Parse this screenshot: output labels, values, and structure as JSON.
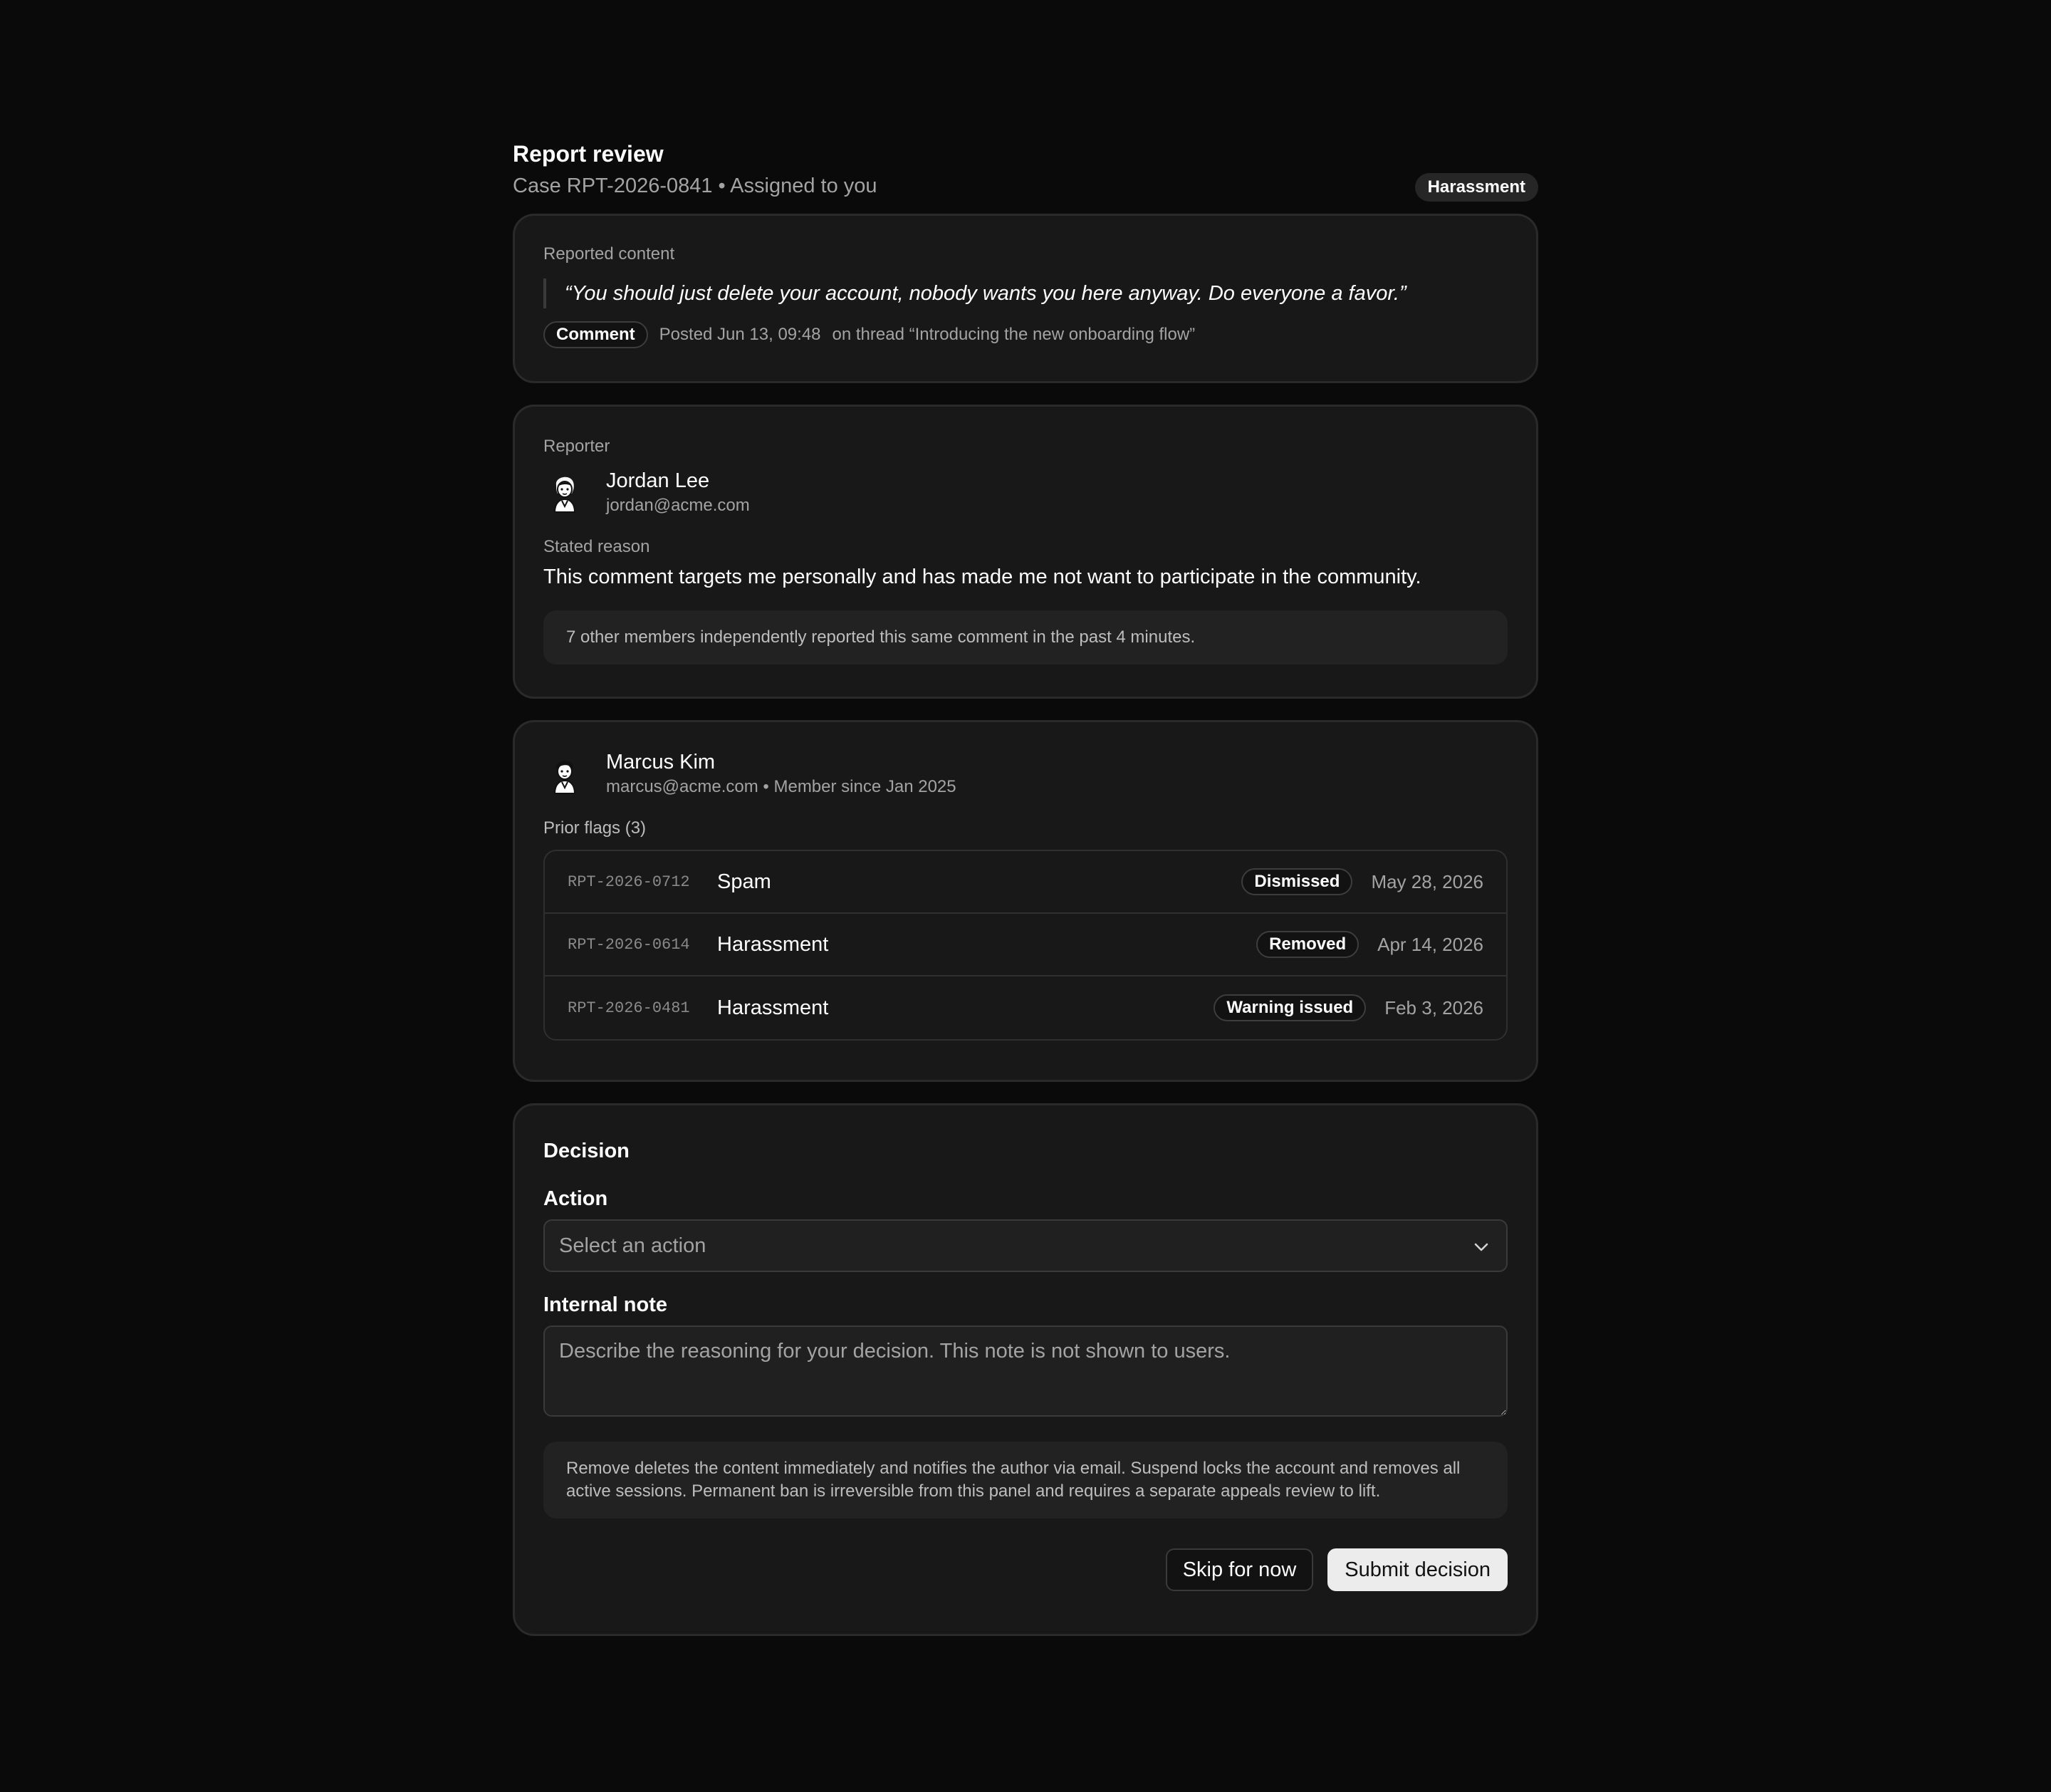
{
  "header": {
    "title": "Report review",
    "subtitle": "Case RPT-2026-0841 • Assigned to you",
    "category_badge": "Harassment"
  },
  "reported_content": {
    "label": "Reported content",
    "quote": "“You should just delete your account, nobody wants you here anyway. Do everyone a favor.”",
    "type_badge": "Comment",
    "posted": "Posted Jun 13, 09:48",
    "thread": "on thread “Introducing the new onboarding flow”"
  },
  "reporter": {
    "label": "Reporter",
    "name": "Jordan Lee",
    "email": "jordan@acme.com",
    "reason_label": "Stated reason",
    "reason": "This comment targets me personally and has made me not want to participate in the community.",
    "note": "7 other members independently reported this same comment in the past 4 minutes."
  },
  "author": {
    "name": "Marcus Kim",
    "details": "marcus@acme.com • Member since Jan 2025",
    "flags_label": "Prior flags (3)",
    "flags": [
      {
        "id": "RPT-2026-0712",
        "type": "Spam",
        "status": "Dismissed",
        "date": "May 28, 2026"
      },
      {
        "id": "RPT-2026-0614",
        "type": "Harassment",
        "status": "Removed",
        "date": "Apr 14, 2026"
      },
      {
        "id": "RPT-2026-0481",
        "type": "Harassment",
        "status": "Warning issued",
        "date": "Feb 3, 2026"
      }
    ]
  },
  "decision": {
    "title": "Decision",
    "action_label": "Action",
    "action_placeholder": "Select an action",
    "note_label": "Internal note",
    "note_placeholder": "Describe the reasoning for your decision. This note is not shown to users.",
    "info": "Remove deletes the content immediately and notifies the author via email. Suspend locks the account and removes all active sessions. Permanent ban is irreversible from this panel and requires a separate appeals review to lift.",
    "skip_label": "Skip for now",
    "submit_label": "Submit decision"
  },
  "icons": {
    "avatar": "avatar-icon",
    "chevron": "chevron-down-icon"
  }
}
